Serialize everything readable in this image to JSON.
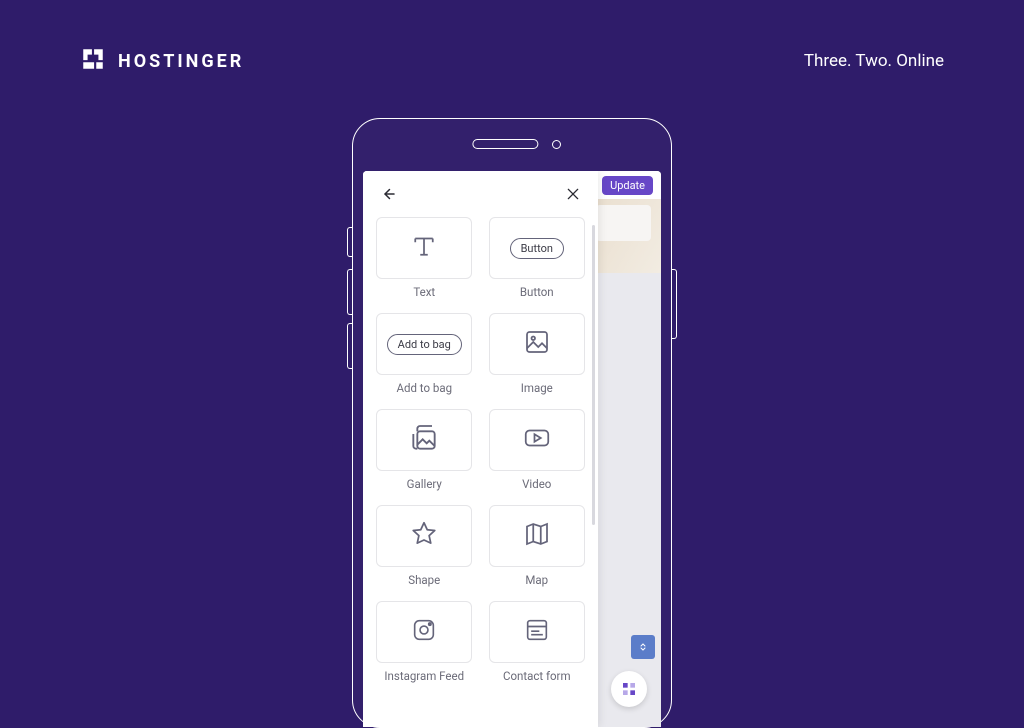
{
  "brand": {
    "name": "HOSTINGER",
    "tagline": "Three. Two. Online"
  },
  "preview": {
    "update_label": "Update"
  },
  "sheet": {
    "items": [
      {
        "key": "text",
        "label": "Text"
      },
      {
        "key": "button",
        "label": "Button",
        "pill": "Button"
      },
      {
        "key": "add-to-bag",
        "label": "Add to bag",
        "pill": "Add to bag"
      },
      {
        "key": "image",
        "label": "Image"
      },
      {
        "key": "gallery",
        "label": "Gallery"
      },
      {
        "key": "video",
        "label": "Video"
      },
      {
        "key": "shape",
        "label": "Shape"
      },
      {
        "key": "map",
        "label": "Map"
      },
      {
        "key": "instagram",
        "label": "Instagram Feed"
      },
      {
        "key": "contact",
        "label": "Contact form"
      }
    ]
  }
}
